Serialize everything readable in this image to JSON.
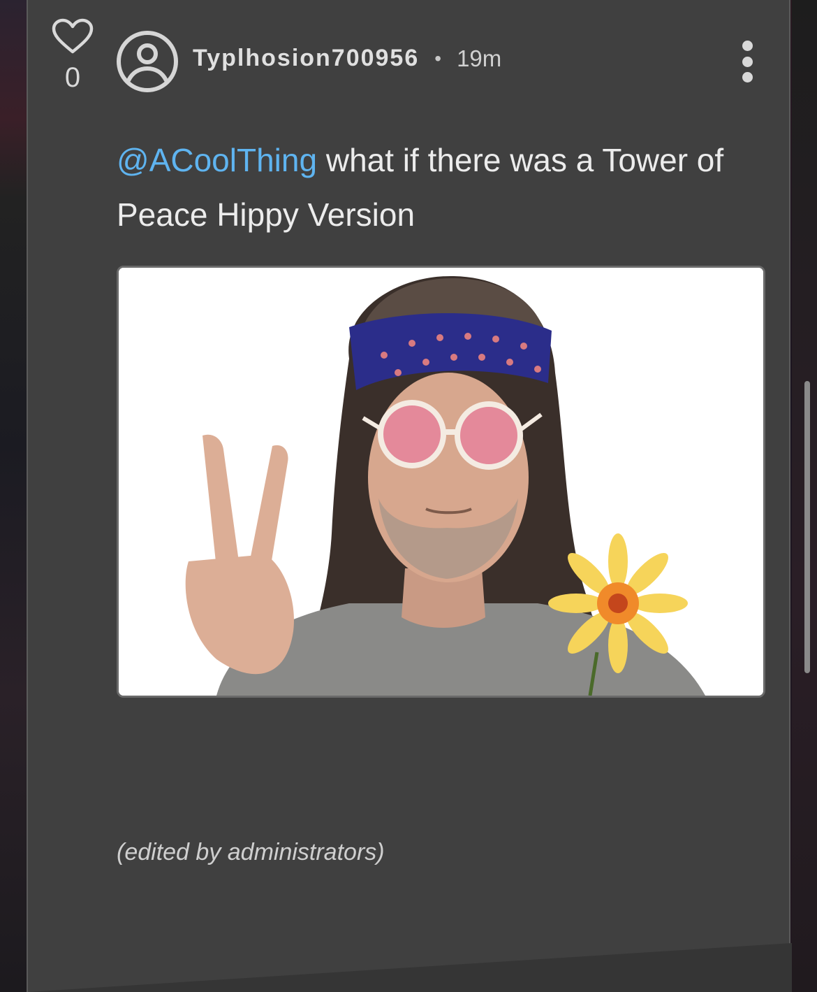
{
  "post": {
    "like_count": "0",
    "username": "Typlhosion700956",
    "separator": "•",
    "timestamp": "19m",
    "mention": "@ACoolThing",
    "body_text": " what if there was a Tower of Peace Hippy Version",
    "edited_note": "(edited by administrators)"
  },
  "icons": {
    "like": "heart-outline-icon",
    "avatar": "user-circle-icon",
    "menu": "vertical-ellipsis-icon"
  },
  "colors": {
    "card_background": "#404040",
    "mention": "#5fb4f0",
    "text": "#ececec"
  }
}
